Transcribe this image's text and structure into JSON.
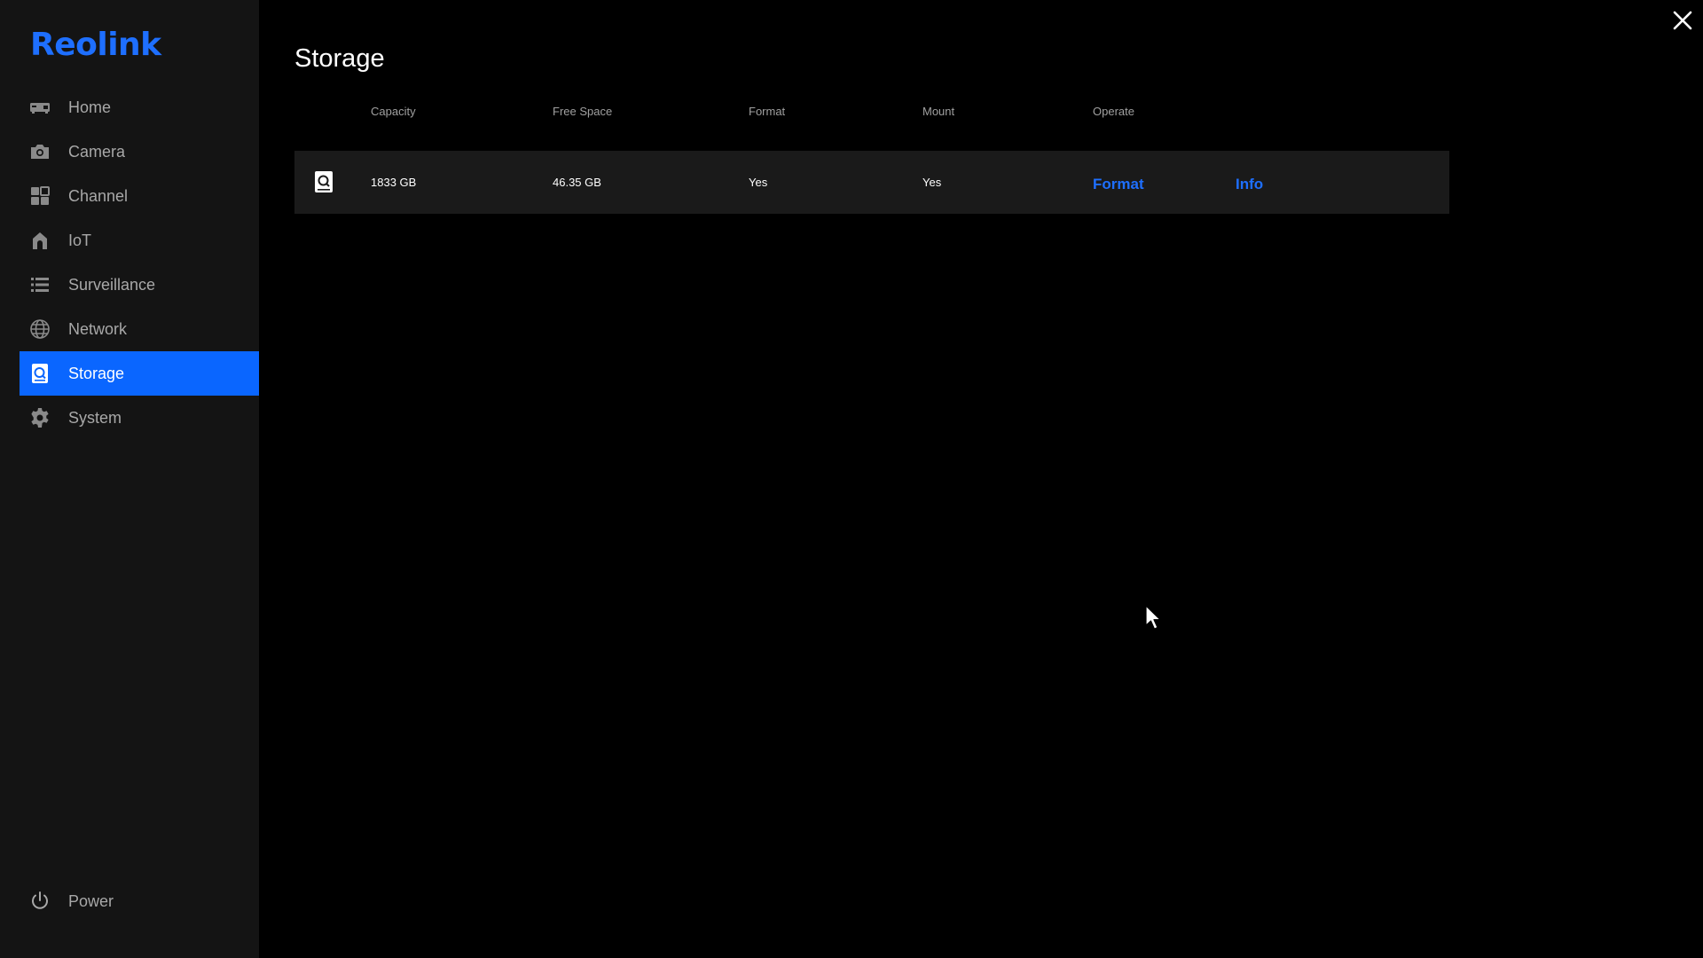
{
  "brand": {
    "logo_text": "Reolink",
    "accent": "#0a66ff"
  },
  "sidebar": {
    "items": [
      {
        "label": "Home",
        "icon": "nvr-device-icon"
      },
      {
        "label": "Camera",
        "icon": "camera-icon"
      },
      {
        "label": "Channel",
        "icon": "grid-icon"
      },
      {
        "label": "IoT",
        "icon": "iot-home-icon"
      },
      {
        "label": "Surveillance",
        "icon": "list-icon"
      },
      {
        "label": "Network",
        "icon": "globe-icon"
      },
      {
        "label": "Storage",
        "icon": "hdd-icon",
        "active": true
      },
      {
        "label": "System",
        "icon": "gear-icon"
      }
    ],
    "power": {
      "label": "Power",
      "icon": "power-icon"
    }
  },
  "main": {
    "title": "Storage",
    "table": {
      "headers": {
        "capacity": "Capacity",
        "free_space": "Free Space",
        "format": "Format",
        "mount": "Mount",
        "operate": "Operate"
      },
      "rows": [
        {
          "icon": "hdd-icon",
          "capacity": "1833 GB",
          "free_space": "46.35 GB",
          "format": "Yes",
          "mount": "Yes",
          "actions": {
            "format": "Format",
            "info": "Info"
          }
        }
      ]
    }
  },
  "window": {
    "close_icon": "close-icon"
  }
}
